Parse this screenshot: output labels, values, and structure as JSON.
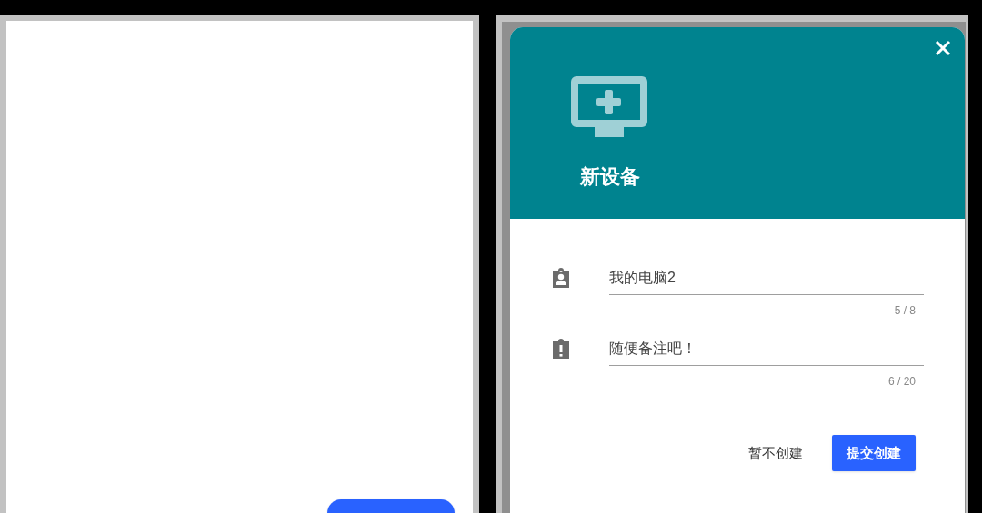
{
  "dialog": {
    "title": "新设备",
    "fields": [
      {
        "kind": "person",
        "value": "我的电脑2",
        "counter": "5 / 8"
      },
      {
        "kind": "alert",
        "value": "随便备注吧！",
        "counter": "6 / 20"
      }
    ],
    "buttons": [
      {
        "kind": "text",
        "label": "暂不创建"
      },
      {
        "kind": "primary",
        "label": "提交创建"
      }
    ]
  }
}
